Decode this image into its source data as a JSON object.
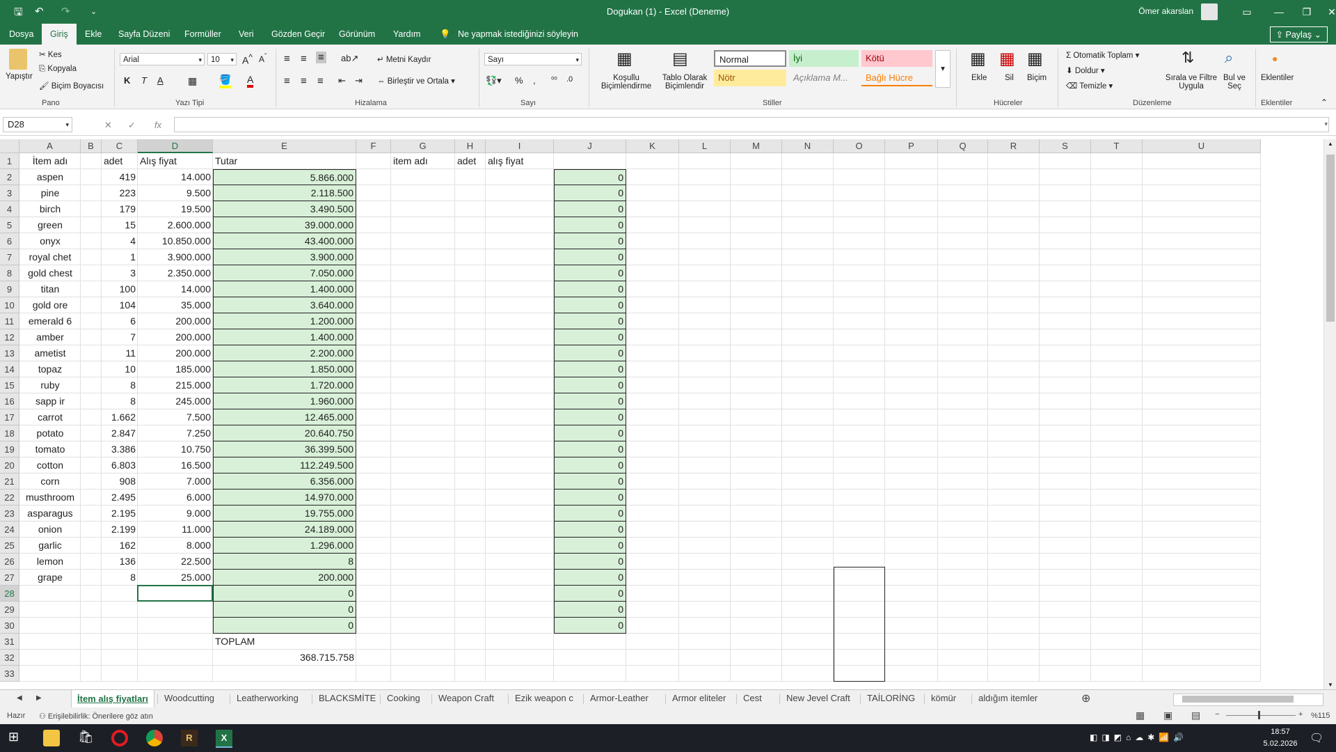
{
  "titlebar": {
    "title": "Dogukan (1)  -  Excel (Deneme)",
    "user": "Ömer akarslan",
    "min": "—",
    "restore": "❐",
    "close": "✕",
    "ribbon_display": "▭"
  },
  "menu": {
    "tabs": [
      "Dosya",
      "Giriş",
      "Ekle",
      "Sayfa Düzeni",
      "Formüller",
      "Veri",
      "Gözden Geçir",
      "Görünüm",
      "Yardım"
    ],
    "tellme": "Ne yapmak istediğinizi söyleyin",
    "share": "Paylaş"
  },
  "ribbon": {
    "pano": {
      "paste": "Yapıştır",
      "cut": "Kes",
      "copy": "Kopyala",
      "format_painter": "Biçim Boyacısı",
      "label": "Pano"
    },
    "font": {
      "name": "Arial",
      "size": "10",
      "label": "Yazı Tipi"
    },
    "align": {
      "wrap": "Metni Kaydır",
      "merge": "Birleştir ve Ortala",
      "label": "Hizalama"
    },
    "number": {
      "format": "Sayı",
      "label": "Sayı"
    },
    "styles": {
      "cond": "Koşullu Biçimlendirme",
      "table": "Tablo Olarak Biçimlendir",
      "normal": "Normal",
      "iyi": "İyi",
      "kotu": "Kötü",
      "notr": "Nötr",
      "aciklama": "Açıklama M...",
      "bagli": "Bağlı Hücre",
      "label": "Stiller"
    },
    "cells": {
      "insert": "Ekle",
      "delete": "Sil",
      "format": "Biçim",
      "label": "Hücreler"
    },
    "editing": {
      "autosum": "Otomatik Toplam",
      "fill": "Doldur",
      "clear": "Temizle",
      "sort": "Sırala ve Filtre Uygula",
      "find": "Bul ve Seç",
      "label": "Düzenleme"
    },
    "addins": {
      "addins": "Eklentiler",
      "label": "Eklentiler"
    }
  },
  "formula_bar": {
    "name_box": "D28",
    "fx": "fx",
    "value": ""
  },
  "colors": {
    "green_fill": "#d8f0d8",
    "excel_green": "#217346"
  },
  "columns": [
    "A",
    "B",
    "C",
    "D",
    "E",
    "F",
    "G",
    "H",
    "I",
    "J",
    "K",
    "L",
    "M",
    "N",
    "O",
    "P",
    "Q",
    "R",
    "S",
    "T",
    "U"
  ],
  "headers_row": {
    "a": "İtem adı",
    "c": "adet",
    "d": "Alış fiyat",
    "e": "Tutar",
    "g": "item adı",
    "h": "adet",
    "i": "alış fiyat"
  },
  "rows": [
    {
      "name": "aspen",
      "qty": "419",
      "price": "14.000",
      "total": "5.866.000",
      "j": "0"
    },
    {
      "name": "pine",
      "qty": "223",
      "price": "9.500",
      "total": "2.118.500",
      "j": "0"
    },
    {
      "name": "birch",
      "qty": "179",
      "price": "19.500",
      "total": "3.490.500",
      "j": "0"
    },
    {
      "name": "green",
      "qty": "15",
      "price": "2.600.000",
      "total": "39.000.000",
      "j": "0"
    },
    {
      "name": "onyx",
      "qty": "4",
      "price": "10.850.000",
      "total": "43.400.000",
      "j": "0"
    },
    {
      "name": "royal chet",
      "qty": "1",
      "price": "3.900.000",
      "total": "3.900.000",
      "j": "0"
    },
    {
      "name": "gold chest",
      "qty": "3",
      "price": "2.350.000",
      "total": "7.050.000",
      "j": "0"
    },
    {
      "name": "titan",
      "qty": "100",
      "price": "14.000",
      "total": "1.400.000",
      "j": "0"
    },
    {
      "name": "gold ore",
      "qty": "104",
      "price": "35.000",
      "total": "3.640.000",
      "j": "0"
    },
    {
      "name": "emerald 6",
      "qty": "6",
      "price": "200.000",
      "total": "1.200.000",
      "j": "0"
    },
    {
      "name": "amber",
      "qty": "7",
      "price": "200.000",
      "total": "1.400.000",
      "j": "0"
    },
    {
      "name": "ametist",
      "qty": "11",
      "price": "200.000",
      "total": "2.200.000",
      "j": "0"
    },
    {
      "name": "topaz",
      "qty": "10",
      "price": "185.000",
      "total": "1.850.000",
      "j": "0"
    },
    {
      "name": "ruby",
      "qty": "8",
      "price": "215.000",
      "total": "1.720.000",
      "j": "0"
    },
    {
      "name": "sapp ir",
      "qty": "8",
      "price": "245.000",
      "total": "1.960.000",
      "j": "0"
    },
    {
      "name": "carrot",
      "qty": "1.662",
      "price": "7.500",
      "total": "12.465.000",
      "j": "0"
    },
    {
      "name": "potato",
      "qty": "2.847",
      "price": "7.250",
      "total": "20.640.750",
      "j": "0"
    },
    {
      "name": "tomato",
      "qty": "3.386",
      "price": "10.750",
      "total": "36.399.500",
      "j": "0"
    },
    {
      "name": "cotton",
      "qty": "6.803",
      "price": "16.500",
      "total": "112.249.500",
      "j": "0"
    },
    {
      "name": "corn",
      "qty": "908",
      "price": "7.000",
      "total": "6.356.000",
      "j": "0"
    },
    {
      "name": "musthroom",
      "qty": "2.495",
      "price": "6.000",
      "total": "14.970.000",
      "j": "0"
    },
    {
      "name": "asparagus",
      "qty": "2.195",
      "price": "9.000",
      "total": "19.755.000",
      "j": "0"
    },
    {
      "name": "onion",
      "qty": "2.199",
      "price": "11.000",
      "total": "24.189.000",
      "j": "0"
    },
    {
      "name": "garlic",
      "qty": "162",
      "price": "8.000",
      "total": "1.296.000",
      "j": "0"
    },
    {
      "name": "lemon",
      "qty": "136",
      "price": "22.500",
      "total": "8",
      "j": "0"
    },
    {
      "name": "grape",
      "qty": "8",
      "price": "25.000",
      "total": "200.000",
      "j": "0"
    },
    {
      "name": "",
      "qty": "",
      "price": "",
      "total": "0",
      "j": "0"
    },
    {
      "name": "",
      "qty": "",
      "price": "",
      "total": "0",
      "j": "0"
    },
    {
      "name": "",
      "qty": "",
      "price": "",
      "total": "0",
      "j": "0"
    }
  ],
  "totals": {
    "label": "TOPLAM",
    "value": "368.715.758"
  },
  "sheets": [
    "İtem alış fiyatları",
    "Woodcutting",
    "Leatherworking",
    "BLACKSMİTE",
    "Cooking",
    "Weapon Craft",
    "Ezik weapon c",
    "Armor-Leather",
    "Armor eliteler",
    "Cest",
    "New Jevel Craft",
    "TAİLORİNG",
    "kömür",
    "aldığım itemler"
  ],
  "status": {
    "ready": "Hazır",
    "accessibility": "Erişilebilirlik: Önerilere göz atın",
    "zoom": "%115"
  },
  "taskbar": {
    "time": "18:57",
    "date": "5.02.2026"
  }
}
